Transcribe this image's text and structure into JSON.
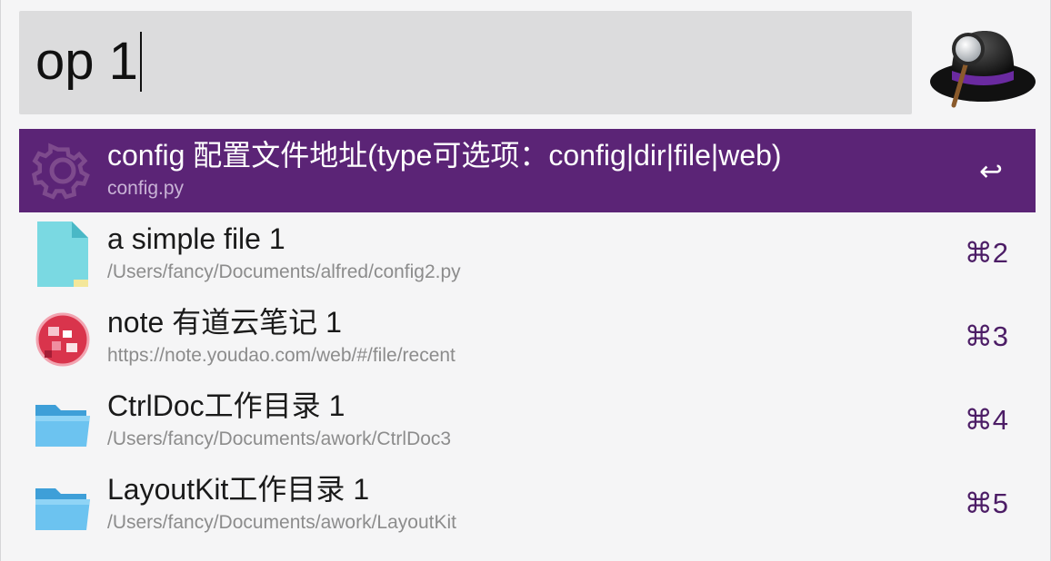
{
  "search": {
    "query": "op 1"
  },
  "results": [
    {
      "title": "config 配置文件地址(type可选项：config|dir|file|web)",
      "subtitle": "config.py",
      "shortcut": "↩",
      "icon": "gear-icon",
      "selected": true
    },
    {
      "title": "a simple file 1",
      "subtitle": "/Users/fancy/Documents/alfred/config2.py",
      "shortcut": "⌘2",
      "icon": "file-icon"
    },
    {
      "title": "note 有道云笔记 1",
      "subtitle": "https://note.youdao.com/web/#/file/recent",
      "shortcut": "⌘3",
      "icon": "youdao-note-icon"
    },
    {
      "title": "CtrlDoc工作目录 1",
      "subtitle": "/Users/fancy/Documents/awork/CtrlDoc3",
      "shortcut": "⌘4",
      "icon": "folder-icon"
    },
    {
      "title": "LayoutKit工作目录 1",
      "subtitle": "/Users/fancy/Documents/awork/LayoutKit",
      "shortcut": "⌘5",
      "icon": "folder-icon"
    }
  ],
  "colors": {
    "selection": "#5b2476",
    "shortcut": "#4c1d66",
    "search_background": "#dcdcdd"
  }
}
